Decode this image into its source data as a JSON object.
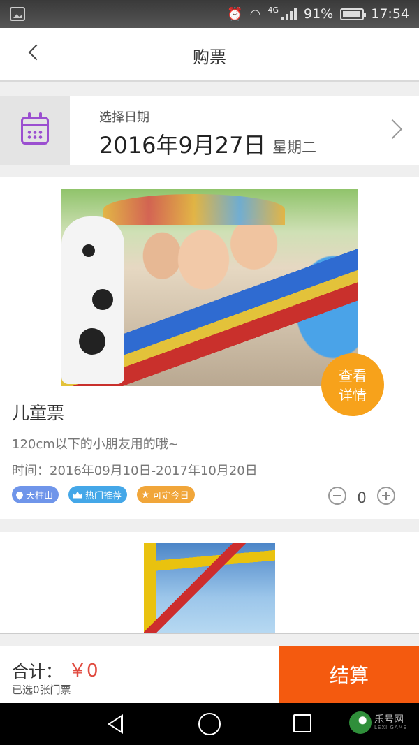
{
  "status_bar": {
    "network": "4G",
    "battery": "91%",
    "time": "17:54"
  },
  "header": {
    "title": "购票"
  },
  "date_selector": {
    "label": "选择日期",
    "date": "2016年9月27日",
    "weekday": "星期二"
  },
  "tickets": [
    {
      "name": "儿童票",
      "description": "120cm以下的小朋友用的哦~",
      "time": "时间：2016年09月10日-2017年10月20日",
      "detail_button": [
        "查看",
        "详情"
      ],
      "tags": [
        {
          "label": "天柱山",
          "icon": "location-pin-icon",
          "color": "#6f95ea"
        },
        {
          "label": "热门推荐",
          "icon": "crown-icon",
          "color": "#44a7e8"
        },
        {
          "label": "可定今日",
          "icon": "star-icon",
          "color": "#f1a63a"
        }
      ],
      "quantity": "0"
    }
  ],
  "footer": {
    "total_label": "合计：",
    "total_value": "￥0",
    "selected_count": "已选0张门票",
    "checkout_label": "结算"
  },
  "watermark": {
    "text": "乐号网",
    "sub": "LEXI GAME"
  },
  "colors": {
    "accent_orange": "#f45a0f",
    "detail_button": "#f7a21b",
    "price_red": "#e04a3f",
    "calendar_purple": "#9b4fd0"
  }
}
